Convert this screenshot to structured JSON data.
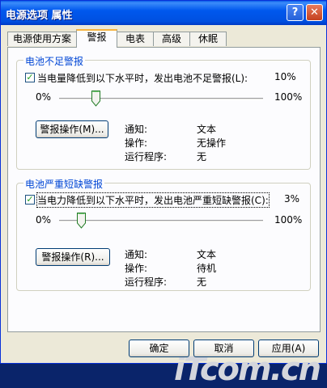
{
  "window": {
    "title": "电源选项 属性",
    "help_glyph": "?",
    "close_glyph": "✕"
  },
  "tabs": [
    {
      "label": "电源使用方案"
    },
    {
      "label": "警报"
    },
    {
      "label": "电表"
    },
    {
      "label": "高级"
    },
    {
      "label": "休眠"
    }
  ],
  "low_battery": {
    "group_title": "电池不足警报",
    "checkbox_label": "当电量降低到以下水平时，发出电池不足警报(L):",
    "checked": true,
    "level_percent": 10,
    "level_text": "10%",
    "slider_min": "0%",
    "slider_max": "100%",
    "action_button": "警报操作(M)...",
    "info": [
      {
        "key": "通知:",
        "value": "文本"
      },
      {
        "key": "操作:",
        "value": "无操作"
      },
      {
        "key": "运行程序:",
        "value": "无"
      }
    ]
  },
  "critical_battery": {
    "group_title": "电池严重短缺警报",
    "checkbox_label": "当电力降低到以下水平时，发出电池严重短缺警报(C):",
    "checked": true,
    "level_percent": 3,
    "level_text": "3%",
    "slider_min": "0%",
    "slider_max": "100%",
    "action_button": "警报操作(R)...",
    "info": [
      {
        "key": "通知:",
        "value": "文本"
      },
      {
        "key": "操作:",
        "value": "待机"
      },
      {
        "key": "运行程序:",
        "value": "无"
      }
    ]
  },
  "buttons": {
    "ok": "确定",
    "cancel": "取消",
    "apply": "应用(A)"
  },
  "watermark": "iTcom.cn",
  "colors": {
    "titlebar": "#0058ee",
    "group_title": "#0046d5",
    "active_tab_accent": "#f7b43e",
    "window_bg": "#ece9d8"
  }
}
